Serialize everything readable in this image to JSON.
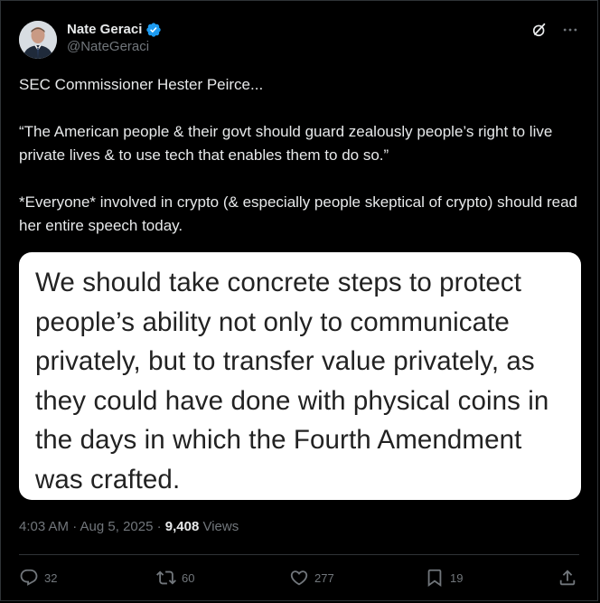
{
  "author": {
    "display_name": "Nate Geraci",
    "handle": "@NateGeraci",
    "verified": true
  },
  "tweet": {
    "paragraphs": [
      "SEC Commissioner Hester Peirce...",
      "“The American people & their govt should guard zealously people’s right to live private lives & to use tech that enables them to do so.”",
      "*Everyone* involved in crypto (& especially people skeptical of crypto) should read her entire speech today."
    ],
    "image_text_lines": [
      "We should take concrete steps to protect",
      "people’s ability not only to communicate",
      "privately, but to transfer value privately, as",
      "they could have done with physical coins in",
      "the days in which the Fourth Amendment",
      "was crafted."
    ],
    "timestamp": "4:03 AM · Aug 5, 2025 · ",
    "views_count": "9,408",
    "views_label": " Views"
  },
  "actions": {
    "replies": "32",
    "reposts": "60",
    "likes": "277",
    "bookmarks": "19"
  },
  "icons": {
    "verified": "verified-badge-icon",
    "grok": "grok-icon",
    "more": "more-icon",
    "reply": "reply-icon",
    "repost": "repost-icon",
    "like": "like-icon",
    "bookmark": "bookmark-icon",
    "share": "share-icon"
  },
  "colors": {
    "background": "#000000",
    "text_primary": "#e7e9ea",
    "text_secondary": "#71767b",
    "verified_blue": "#1d9bf0",
    "divider": "#2f3336"
  }
}
